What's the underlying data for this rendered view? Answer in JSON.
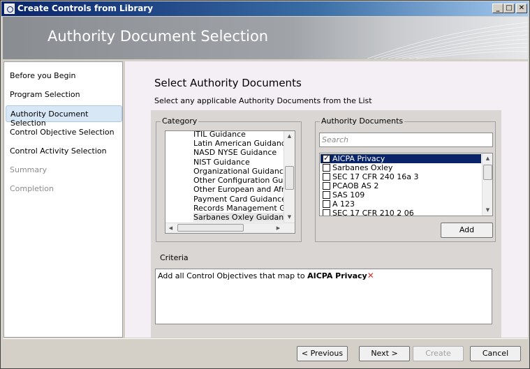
{
  "window": {
    "title": "Create Controls from Library",
    "minimize_glyph": "_",
    "maximize_glyph": "□",
    "close_glyph": "✕"
  },
  "banner": {
    "title": "Authority Document Selection"
  },
  "sidebar": {
    "items": [
      {
        "label": "Before you Begin",
        "state": "normal"
      },
      {
        "label": "Program Selection",
        "state": "normal"
      },
      {
        "label": "Authority Document Selection",
        "state": "active"
      },
      {
        "label": "Control Objective Selection",
        "state": "normal"
      },
      {
        "label": "Control Activity Selection",
        "state": "normal"
      },
      {
        "label": "Summary",
        "state": "disabled"
      },
      {
        "label": "Completion",
        "state": "disabled"
      }
    ]
  },
  "main": {
    "title": "Select Authority Documents",
    "subtitle": "Select any applicable Authority Documents from the List"
  },
  "category": {
    "legend": "Category",
    "items": [
      "ITIL Guidance",
      "Latin American Guidance",
      "NASD NYSE Guidance",
      "NIST Guidance",
      "Organizational Guidance",
      "Other Configuration Guidance",
      "Other European and African",
      "Payment Card Guidance",
      "Records Management Guidance",
      "Sarbanes Oxley Guidance"
    ],
    "selected_index": 9
  },
  "authority_documents": {
    "legend": "Authority Documents",
    "search_placeholder": "Search",
    "items": [
      {
        "label": "AICPA Privacy",
        "checked": true,
        "selected": true
      },
      {
        "label": "Sarbanes Oxley",
        "checked": false,
        "selected": false
      },
      {
        "label": "SEC 17 CFR 240 16a 3",
        "checked": false,
        "selected": false
      },
      {
        "label": "PCAOB AS 2",
        "checked": false,
        "selected": false
      },
      {
        "label": "SAS 109",
        "checked": false,
        "selected": false
      },
      {
        "label": "A 123",
        "checked": false,
        "selected": false
      },
      {
        "label": "SEC 17 CFR 210 2 06",
        "checked": false,
        "selected": false
      }
    ],
    "add_label": "Add"
  },
  "criteria": {
    "label": "Criteria",
    "prefix": "Add all Control Objectives that map to ",
    "document": "AICPA Privacy",
    "remove_glyph": "✕"
  },
  "footer": {
    "previous_label": "< Previous",
    "next_label": "Next >",
    "create_label": "Create",
    "cancel_label": "Cancel"
  },
  "colors": {
    "selection": "#0a246a",
    "active_nav": "#d8e7f5",
    "remove_icon": "#d9342b"
  }
}
